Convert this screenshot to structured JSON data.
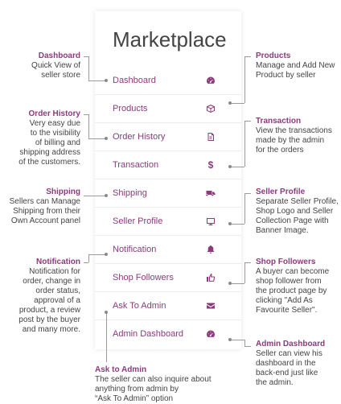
{
  "marketplace": {
    "title": "Marketplace",
    "menu": [
      {
        "label": "Dashboard",
        "icon": "dashboard-gauge-icon"
      },
      {
        "label": "Products",
        "icon": "cube-icon"
      },
      {
        "label": "Order History",
        "icon": "document-icon"
      },
      {
        "label": "Transaction",
        "icon": "dollar-icon"
      },
      {
        "label": "Shipping",
        "icon": "truck-icon"
      },
      {
        "label": "Seller Profile",
        "icon": "monitor-icon"
      },
      {
        "label": "Notification",
        "icon": "bell-icon"
      },
      {
        "label": "Shop Followers",
        "icon": "thumbs-up-icon"
      },
      {
        "label": "Ask To Admin",
        "icon": "envelope-icon"
      },
      {
        "label": "Admin Dashboard",
        "icon": "dashboard-gauge-icon"
      }
    ]
  },
  "annotations": {
    "dashboard": {
      "head": "Dashboard",
      "line1": "Quick View of",
      "line2": "seller store"
    },
    "order_history": {
      "head": "Order History",
      "line1": "Very easy due",
      "line2": "to the visibility",
      "line3": "of billing and",
      "line4": "shipping address",
      "line5": "of the customers."
    },
    "shipping": {
      "head": "Shipping",
      "line1": "Sellers can Manage",
      "line2": "Shipping from their",
      "line3": "Own Account panel"
    },
    "notification": {
      "head": "Notification",
      "line1": "Notification for",
      "line2": "order,  change in",
      "line3": "order  status,",
      "line4": "approval of  a",
      "line5": "product, a review",
      "line6": "post by the buyer",
      "line7": "and many more."
    },
    "products": {
      "head": "Products",
      "line1": "Manage and Add New",
      "line2": "Product by seller"
    },
    "transaction": {
      "head": "Transaction",
      "line1": "View the transactions",
      "line2": "made by the admin",
      "line3": "for the orders"
    },
    "seller_profile": {
      "head": "Seller Profile",
      "line1": "Separate Seller Profile,",
      "line2": "Shop Logo and Seller",
      "line3": "Collection Page with",
      "line4": "Banner Image."
    },
    "shop_followers": {
      "head": "Shop Followers",
      "line1": "A buyer can become",
      "line2": "shop follower from",
      "line3": "the product page by",
      "line4": "clicking \"Add As",
      "line5": "Favourite Seller\"."
    },
    "admin_dashboard": {
      "head": "Admin Dashboard",
      "line1": "Seller can view his",
      "line2": "dashboard in the",
      "line3": "back-end just like",
      "line4": "the admin."
    },
    "ask_admin": {
      "head": "Ask to Admin",
      "line1": "The seller can also inquire about",
      "line2": "anything from admin by",
      "line3": "“Ask To Admin” option"
    }
  }
}
